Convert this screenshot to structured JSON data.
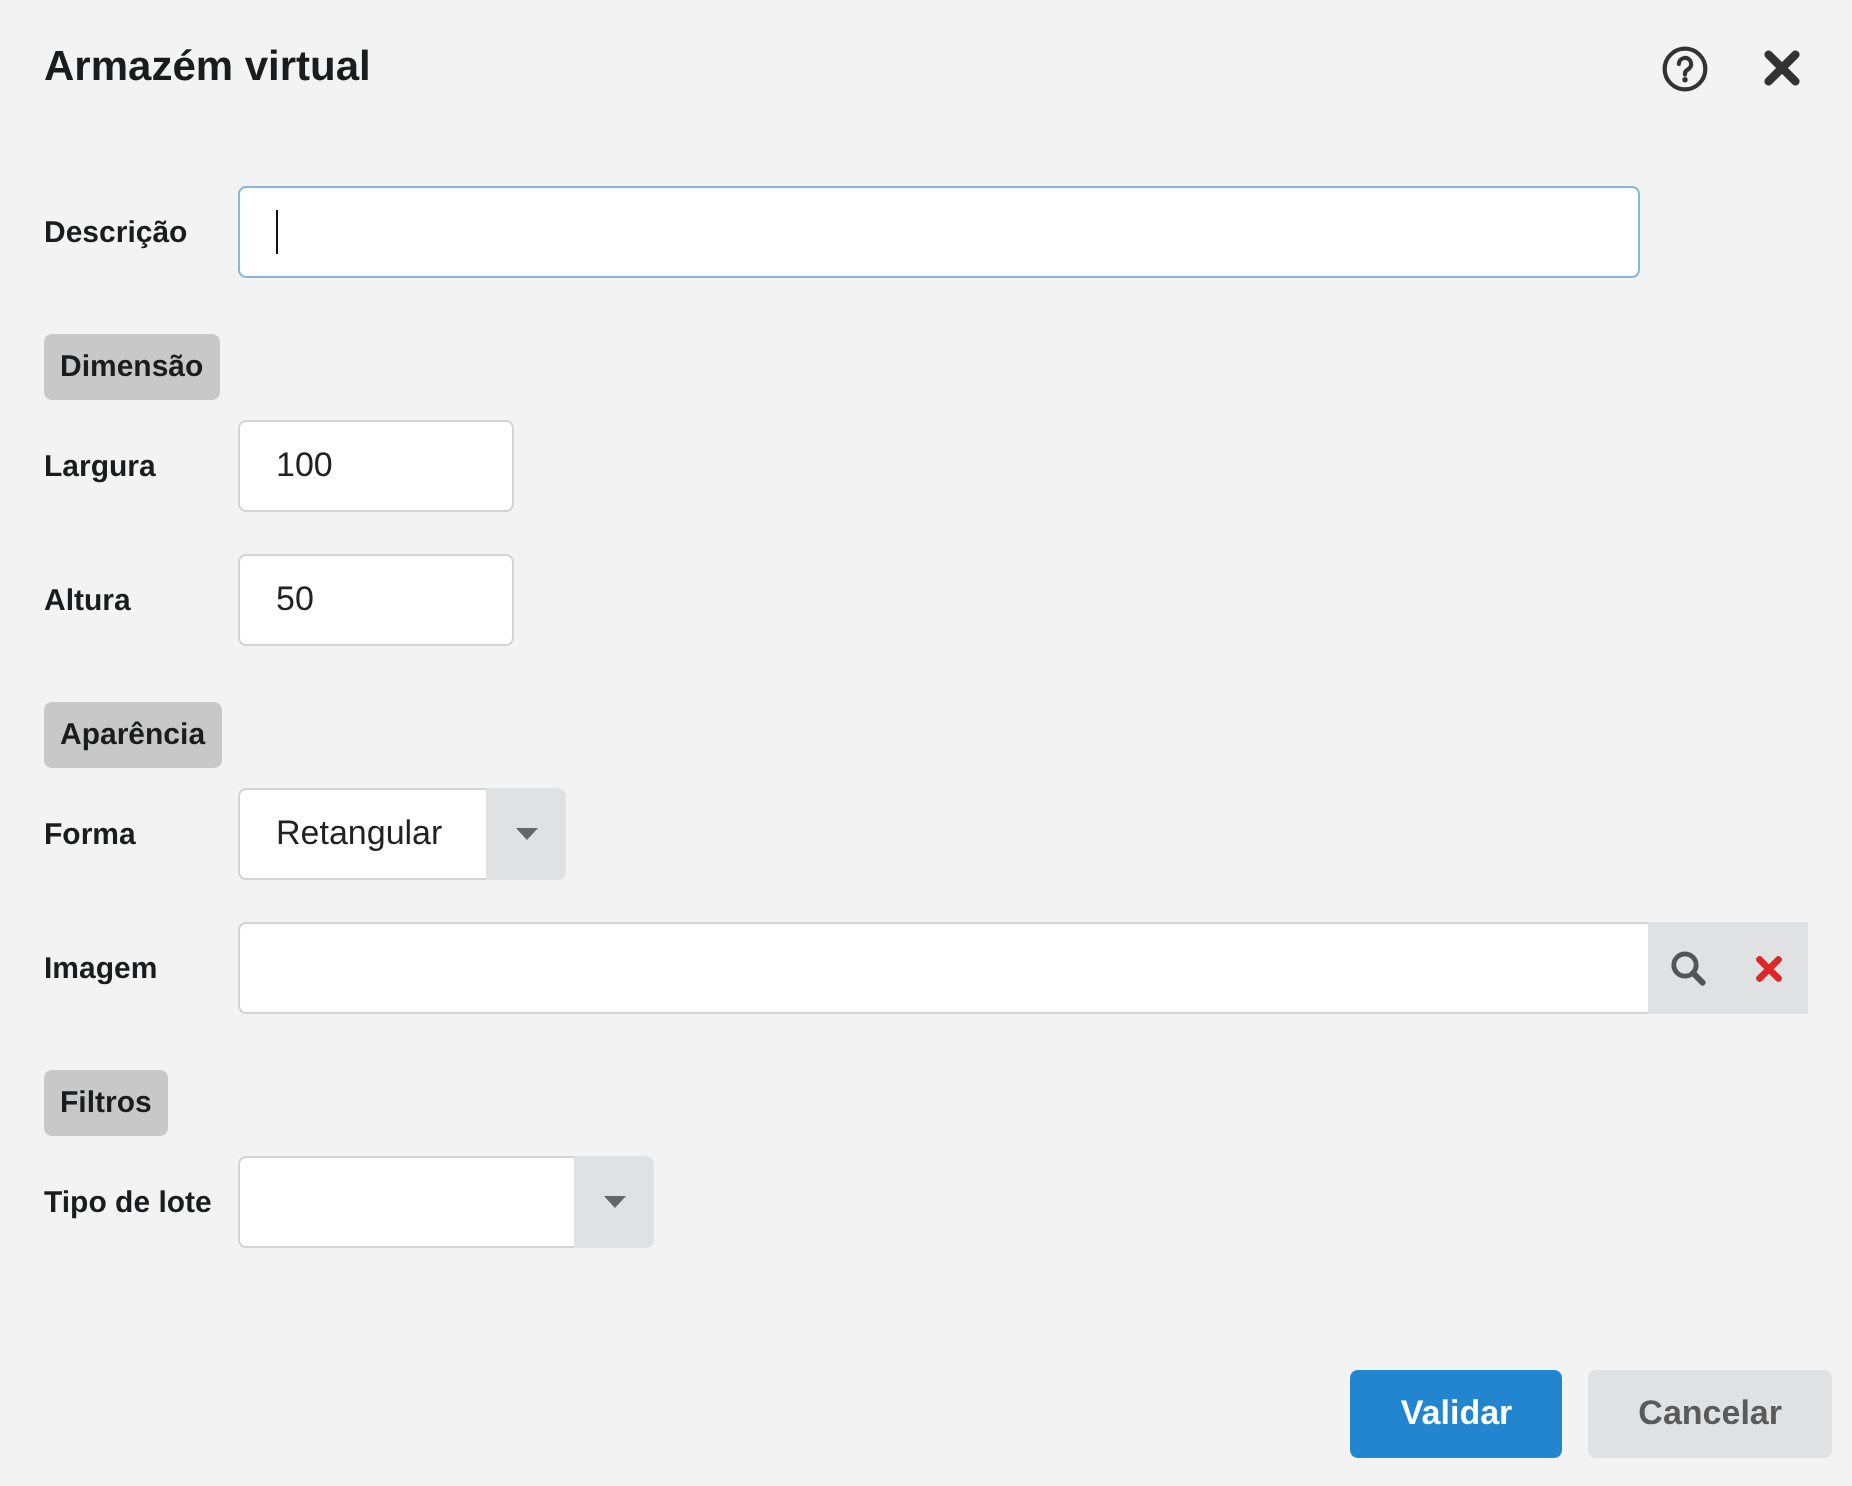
{
  "dialog": {
    "title": "Armazém virtual"
  },
  "form": [
    {
      "kind": "text",
      "label": "Descrição",
      "focused": true
    },
    {
      "kind": "heading",
      "text": "Dimensão"
    },
    {
      "kind": "number",
      "label": "Largura",
      "value": "100",
      "focused": false
    },
    {
      "kind": "number",
      "label": "Altura",
      "value": "50",
      "focused": false
    },
    {
      "kind": "heading",
      "text": "Aparência"
    },
    {
      "kind": "select",
      "label": "Forma",
      "value": "Retangular",
      "focused": false
    },
    {
      "kind": "lookup",
      "label": "Imagem",
      "focused": false
    },
    {
      "kind": "heading",
      "text": "Filtros"
    },
    {
      "kind": "select",
      "label": "Tipo de lote",
      "focused": false
    }
  ],
  "buttons": [
    {
      "label": "Validar",
      "kind": "primary"
    },
    {
      "label": "Cancelar",
      "kind": "secondary"
    }
  ]
}
